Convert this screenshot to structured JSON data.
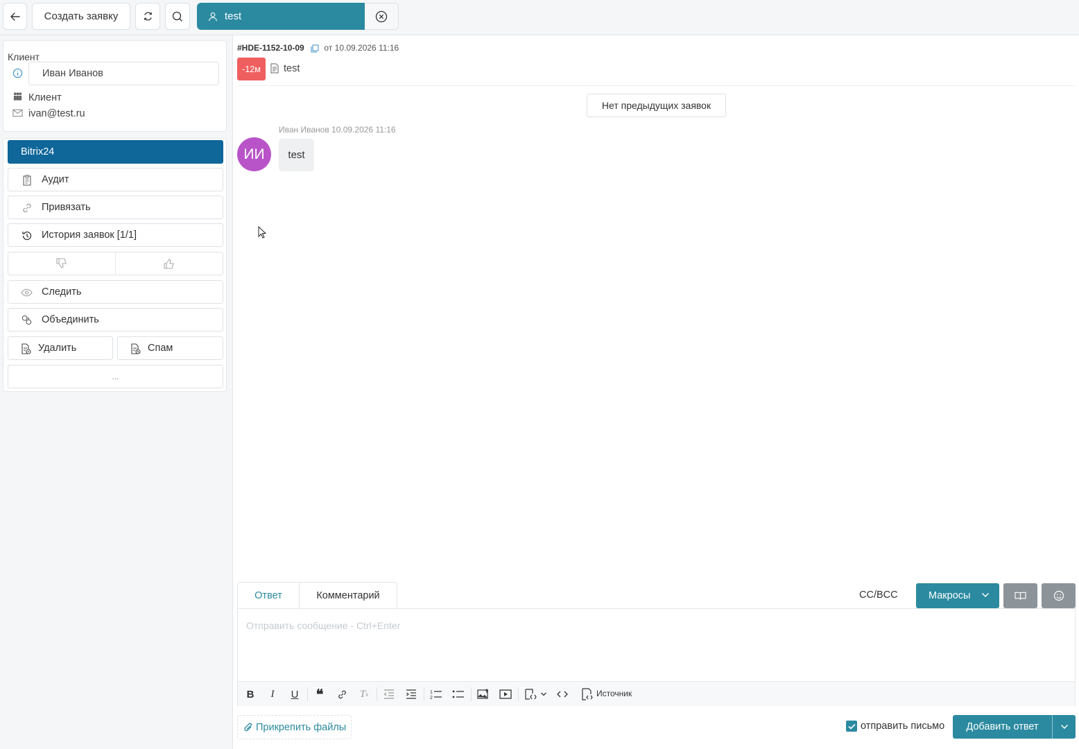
{
  "topbar": {
    "create_label": "Создать заявку",
    "tab_label": "test"
  },
  "client": {
    "title": "Клиент",
    "name": "Иван Иванов",
    "role": "Клиент",
    "email": "ivan@test.ru"
  },
  "actions": {
    "bitrix": "Bitrix24",
    "audit": "Аудит",
    "bind": "Привязать",
    "history": "История заявок [1/1]",
    "follow": "Следить",
    "merge": "Объединить",
    "delete": "Удалить",
    "spam": "Спам",
    "more": "..."
  },
  "ticket": {
    "id": "#HDE-1152-10-09",
    "date": "от 10.09.2026 11:16",
    "timer": "-12м",
    "subject": "test",
    "prev_label": "Нет предыдущих заявок"
  },
  "message": {
    "meta": "Иван Иванов 10.09.2026 11:16",
    "initials": "ИИ",
    "text": "test"
  },
  "reply": {
    "tab_reply": "Ответ",
    "tab_comment": "Комментарий",
    "ccbcc": "CC/BCC",
    "macros": "Макросы",
    "placeholder": "Отправить сообщение - Ctrl+Enter",
    "source": "Источник",
    "attach": "Прикрепить файлы",
    "send_email": "отправить письмо",
    "submit": "Добавить ответ"
  },
  "colors": {
    "accent": "#2b8aa0",
    "primary": "#0e6699",
    "danger": "#ef5f5f",
    "avatar": "#b954c8"
  }
}
